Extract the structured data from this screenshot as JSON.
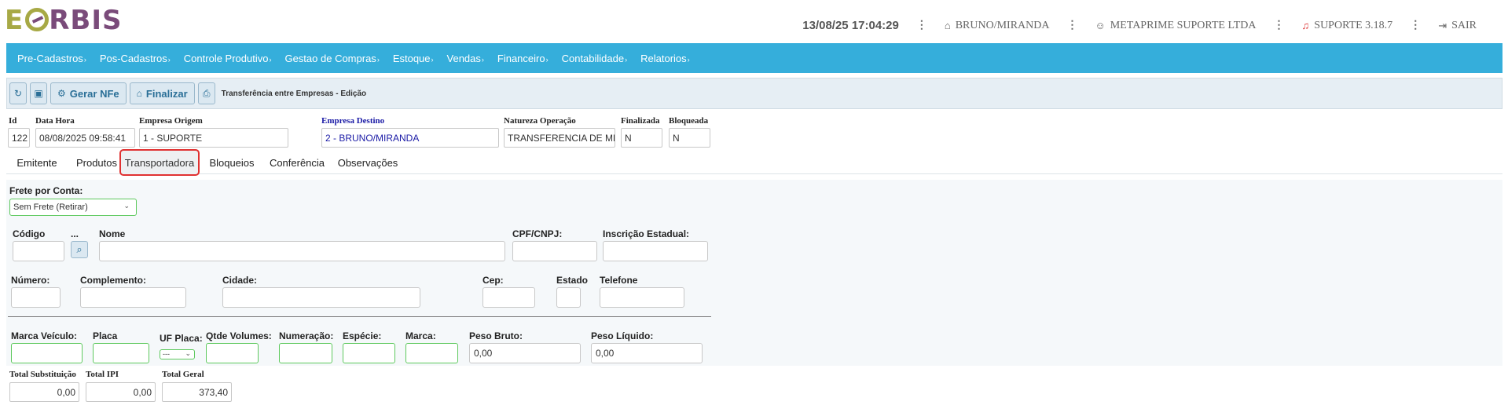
{
  "header": {
    "logo_e": "E",
    "logo_rest": "RBIS",
    "datetime": "13/08/25 17:04:29",
    "branch": "BRUNO/MIRANDA",
    "user": "METAPRIME SUPORTE LTDA",
    "version": "SUPORTE 3.18.7",
    "exit_label": "SAIR",
    "separator": "⋮"
  },
  "menu": [
    "Pre-Cadastros",
    "Pos-Cadastros",
    "Controle Produtivo",
    "Gestao de Compras",
    "Estoque",
    "Vendas",
    "Financeiro",
    "Contabilidade",
    "Relatorios"
  ],
  "menu_arrow": "›",
  "toolbar": {
    "gerar_nfe": "Gerar NFe",
    "finalizar": "Finalizar",
    "title": "Transferência entre Empresas - Edição"
  },
  "header_fields": {
    "id_label": "Id",
    "id_value": "122",
    "datahora_label": "Data Hora",
    "datahora_value": "08/08/2025 09:58:41",
    "origem_label": "Empresa Origem",
    "origem_value": "1 - SUPORTE",
    "destino_label": "Empresa Destino",
    "destino_value": "2 - BRUNO/MIRANDA",
    "natureza_label": "Natureza Operação",
    "natureza_value": "TRANSFERENCIA DE MERC",
    "finalizada_label": "Finalizada",
    "finalizada_value": "N",
    "bloqueada_label": "Bloqueada",
    "bloqueada_value": "N"
  },
  "tabs": [
    "Emitente",
    "Produtos",
    "Transportadora",
    "Bloqueios",
    "Conferência",
    "Observações"
  ],
  "active_tab": "Transportadora",
  "transportadora": {
    "frete_label": "Frete por Conta:",
    "frete_value": "Sem Frete (Retirar)",
    "codigo_label": "Código",
    "ellipsis_label": "...",
    "nome_label": "Nome",
    "cpf_label": "CPF/CNPJ:",
    "ie_label": "Inscrição Estadual:",
    "numero_label": "Número:",
    "complemento_label": "Complemento:",
    "cidade_label": "Cidade:",
    "cep_label": "Cep:",
    "estado_label": "Estado",
    "telefone_label": "Telefone",
    "marca_veiculo_label": "Marca Veículo:",
    "placa_label": "Placa",
    "uf_placa_label": "UF Placa:",
    "uf_placa_value": "---",
    "qtde_volumes_label": "Qtde Volumes:",
    "numeracao_label": "Numeração:",
    "especie_label": "Espécie:",
    "marca_label": "Marca:",
    "peso_bruto_label": "Peso Bruto:",
    "peso_bruto_value": "0,00",
    "peso_liquido_label": "Peso Líquido:",
    "peso_liquido_value": "0,00"
  },
  "totals": {
    "substituicao_label": "Total Substituição",
    "substituicao_value": "0,00",
    "ipi_label": "Total IPI",
    "ipi_value": "0,00",
    "geral_label": "Total Geral",
    "geral_value": "373,40"
  },
  "colors": {
    "menu_bg": "#35aedb",
    "active_tab_border": "#e03131",
    "logo_purple": "#7a4b7a",
    "logo_green": "#a7a945"
  }
}
